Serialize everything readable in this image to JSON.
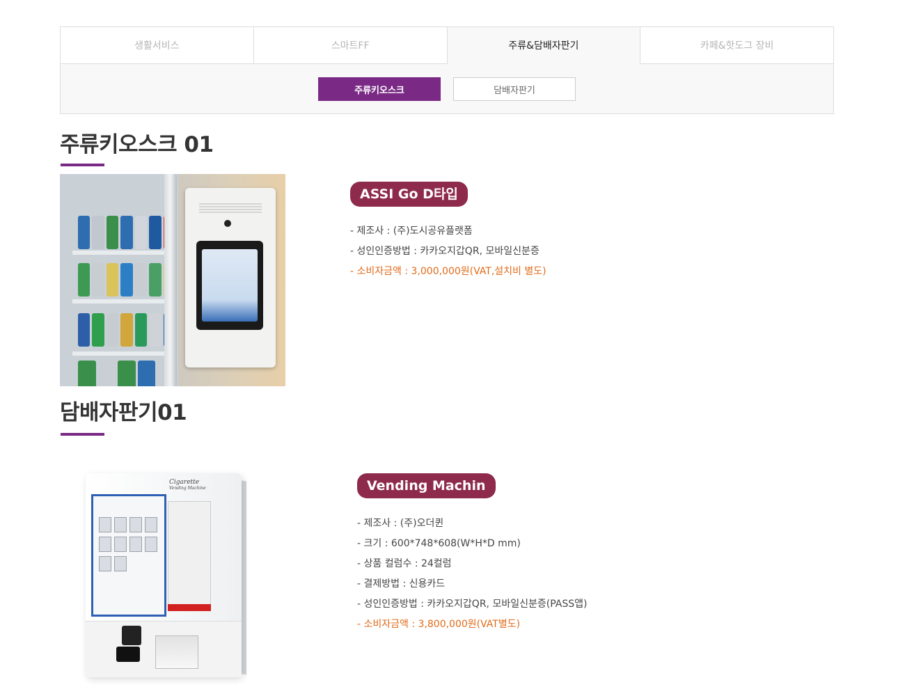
{
  "main_tabs": [
    {
      "label": "생활서비스",
      "active": false
    },
    {
      "label": "스마트FF",
      "active": false
    },
    {
      "label": "주류&담배자판기",
      "active": true
    },
    {
      "label": "카페&핫도그 장비",
      "active": false
    }
  ],
  "sub_tabs": [
    {
      "label": "주류키오스크",
      "active": true
    },
    {
      "label": "담배자판기",
      "active": false
    }
  ],
  "sections": [
    {
      "title": "주류키오스크 01",
      "product_name": "ASSI Go D타입",
      "specs": [
        "제조사 : (주)도시공유플랫폼",
        "성인인증방법 : 카카오지갑QR, 모바일신분증"
      ],
      "price": "소비자금액 : 3,000,000원(VAT,설치비 별도)"
    },
    {
      "title": "담배자판기01",
      "product_name": "Vending Machin",
      "specs": [
        "제조사 : (주)오더퀸",
        "크기 : 600*748*608(W*H*D mm)",
        "상품 컬럼수 : 24컬럼",
        "결제방법 : 신용카드",
        "성인인증방법 : 카카오지갑QR, 모바일신분증(PASS앱)"
      ],
      "price": "소비자금액 : 3,800,000원(VAT별도)",
      "image_text": {
        "brand": "Cigarette",
        "sub": "Vending Machine"
      }
    }
  ],
  "colors": {
    "accent_purple": "#7a2a85",
    "badge": "#8e2a4c",
    "price_orange": "#e06b1a"
  }
}
